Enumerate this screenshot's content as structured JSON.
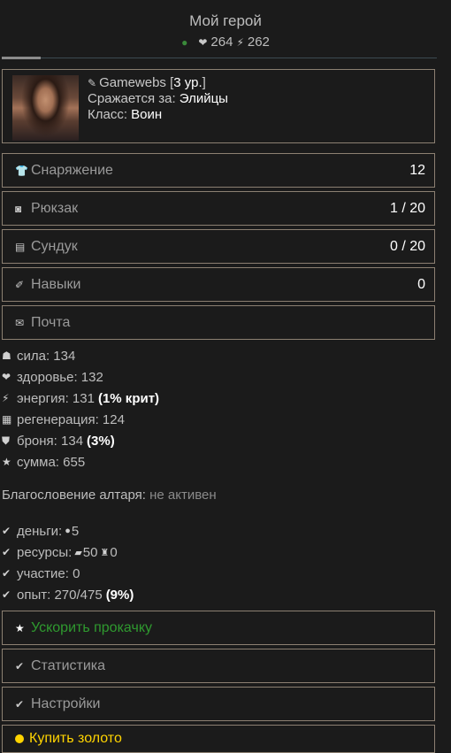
{
  "header": {
    "title": "Мой герой",
    "hp": "264",
    "energy": "262"
  },
  "profile": {
    "name": "Gamewebs",
    "level": "3 ур.",
    "fights_for_label": "Сражается за:",
    "faction": "Элийцы",
    "class_label": "Класс:",
    "class": "Воин"
  },
  "menu": [
    {
      "label": "Снаряжение",
      "value": "12",
      "icon": "shirt-icon"
    },
    {
      "label": "Рюкзак",
      "value": "1 / 20",
      "icon": "backpack-icon"
    },
    {
      "label": "Сундук",
      "value": "0 / 20",
      "icon": "chest-icon"
    },
    {
      "label": "Навыки",
      "value": "0",
      "icon": "skills-icon"
    },
    {
      "label": "Почта",
      "value": "",
      "icon": "mail-icon"
    }
  ],
  "stats": [
    {
      "label": "сила: 134",
      "extra": "",
      "icon": "strength-icon"
    },
    {
      "label": "здоровье: 132",
      "extra": "",
      "icon": "heart-icon"
    },
    {
      "label": "энергия: 131",
      "extra": "(1% крит)",
      "icon": "lightning-icon"
    },
    {
      "label": "регенерация: 124",
      "extra": "",
      "icon": "regen-icon"
    },
    {
      "label": "броня: 134",
      "extra": "(3%)",
      "icon": "shield-icon"
    },
    {
      "label": "сумма: 655",
      "extra": "",
      "icon": "star-icon"
    }
  ],
  "altar": {
    "label": "Благословение алтаря:",
    "status": "не активен"
  },
  "resources": {
    "money_label": "деньги:",
    "money": "5",
    "resources_label": "ресурсы:",
    "res1": "50",
    "res2": "0",
    "participation": "участие: 0",
    "exp": "опыт: 270/475",
    "exp_pct": "(9%)"
  },
  "actions": [
    {
      "label": "Ускорить прокачку",
      "icon": "star-icon"
    },
    {
      "label": "Статистика",
      "icon": "check-icon"
    },
    {
      "label": "Настройки",
      "icon": "check-icon"
    },
    {
      "label": "Купить золото",
      "icon": "gold-coin-icon"
    }
  ]
}
